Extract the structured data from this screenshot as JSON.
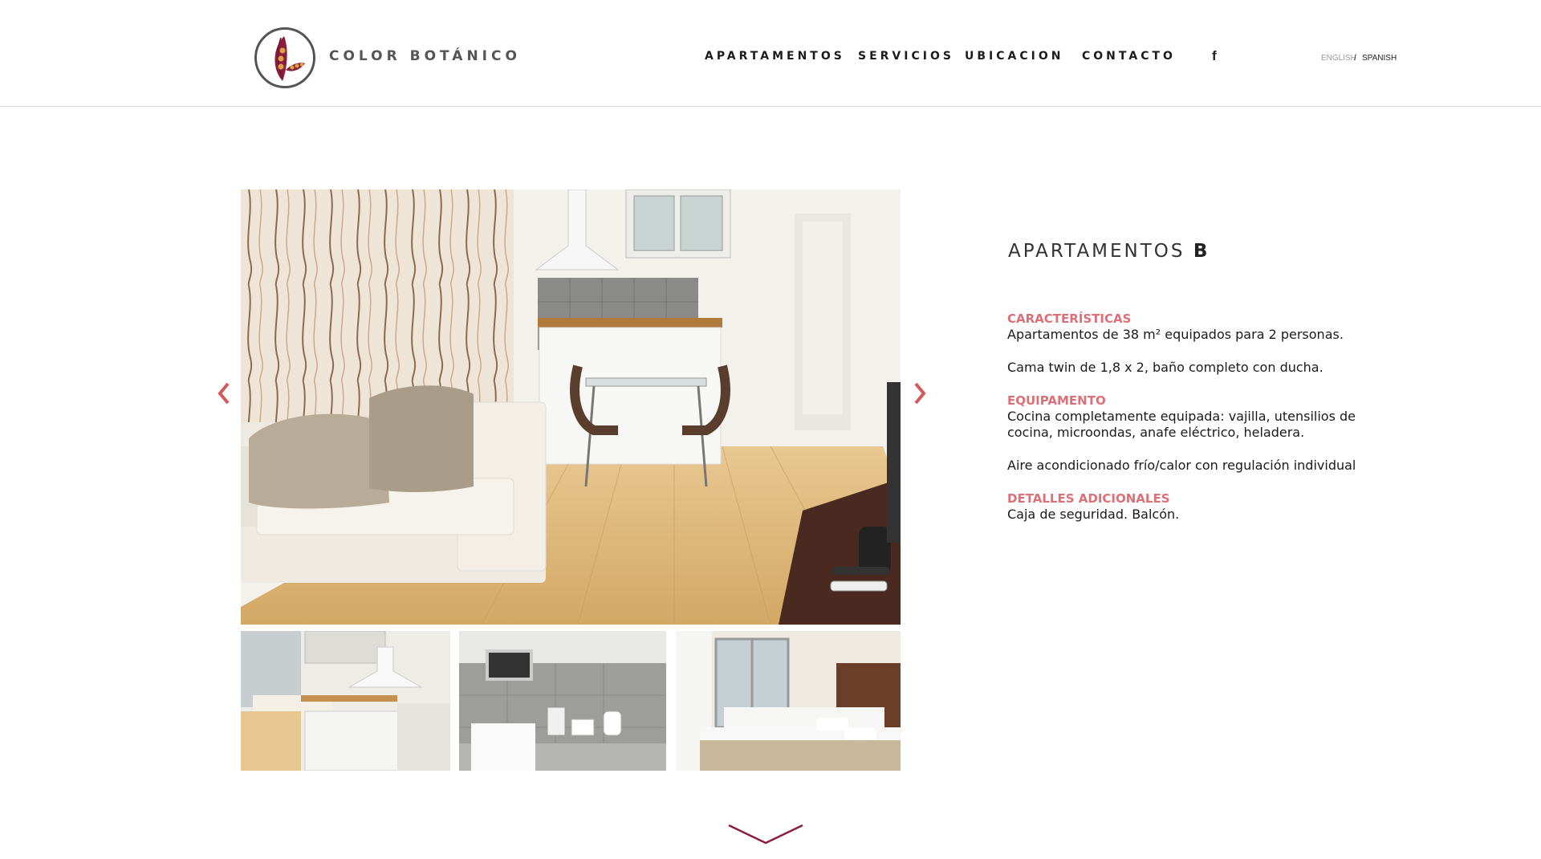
{
  "brand": {
    "name": "COLOR BOTÁNICO"
  },
  "nav": {
    "apartamentos": "APARTAMENTOS",
    "servicios": "SERVICIOS",
    "ubicacion": "UBICACION",
    "contacto": "CONTACTO",
    "facebook": "f"
  },
  "lang": {
    "english": "ENGLISH",
    "separator": "/",
    "spanish": "SPANISH"
  },
  "apartment": {
    "title_light": "APARTAMENTOS",
    "title_bold": "B",
    "caracteristicas_head": "CARACTERÍSTICAS",
    "caracteristicas_1": "Apartamentos de 38 m² equipados para 2 personas.",
    "caracteristicas_2": "Cama twin de 1,8 x 2,  baño completo con ducha.",
    "equipamento_head": "EQUIPAMENTO",
    "equipamento_1a": "Cocina completamente equipada: vajilla, utensilios de",
    "equipamento_1b": "cocina, microondas, anafe eléctrico, heladera.",
    "equipamento_2": "Aire acondicionado frío/calor con regulación individual",
    "detalles_head": "DETALLES ADICIONALES",
    "detalles_1": "Caja de seguridad. Balcón."
  },
  "icons": {
    "logo": "botanical-seed-logo",
    "prev": "chevron-left-icon",
    "next": "chevron-right-icon",
    "scroll": "chevron-down-icon"
  },
  "colors": {
    "accent": "#db7078",
    "logo_maroon": "#8b1e3f",
    "logo_gold": "#d9a441",
    "arrow": "#d35a5a"
  }
}
